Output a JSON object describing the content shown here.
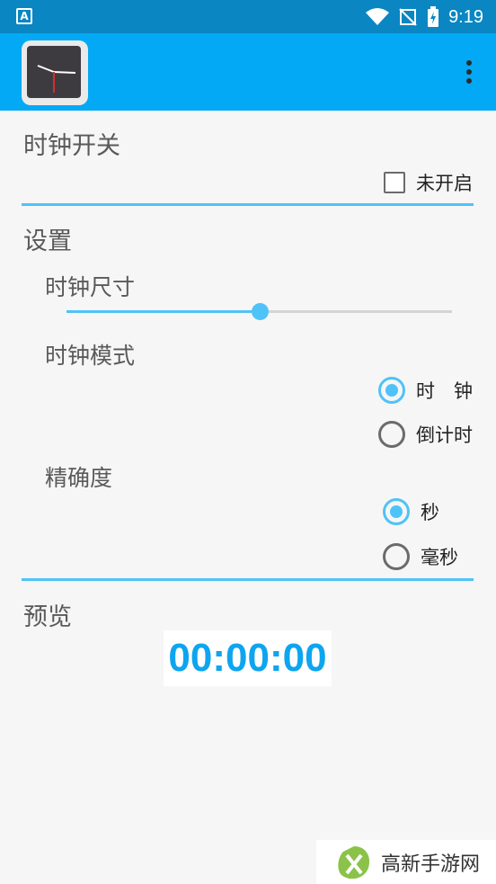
{
  "status_bar": {
    "time": "9:19",
    "left_icon": "A"
  },
  "sections": {
    "clock_switch": {
      "title": "时钟开关",
      "checkbox_label": "未开启",
      "checked": false
    },
    "settings": {
      "title": "设置",
      "clock_size": {
        "label": "时钟尺寸",
        "value_fraction": 0.5
      },
      "clock_mode": {
        "label": "时钟模式",
        "options": [
          {
            "label": "时　钟",
            "selected": true
          },
          {
            "label": "倒计时",
            "selected": false
          }
        ]
      },
      "precision": {
        "label": "精确度",
        "options": [
          {
            "label": "秒",
            "selected": true
          },
          {
            "label": "毫秒",
            "selected": false
          }
        ]
      }
    },
    "preview": {
      "title": "预览",
      "time": "00:00:00"
    }
  },
  "watermark": {
    "text": "高新手游网"
  },
  "colors": {
    "status_bar": "#0a86c2",
    "app_bar": "#03a9f4",
    "accent": "#4fc3f7",
    "preview_text": "#0ea5f0"
  },
  "icons": [
    "app-clock-icon",
    "wifi-icon",
    "no-signal-icon",
    "battery-charging-icon",
    "overflow-menu-icon",
    "watermark-logo-icon"
  ]
}
